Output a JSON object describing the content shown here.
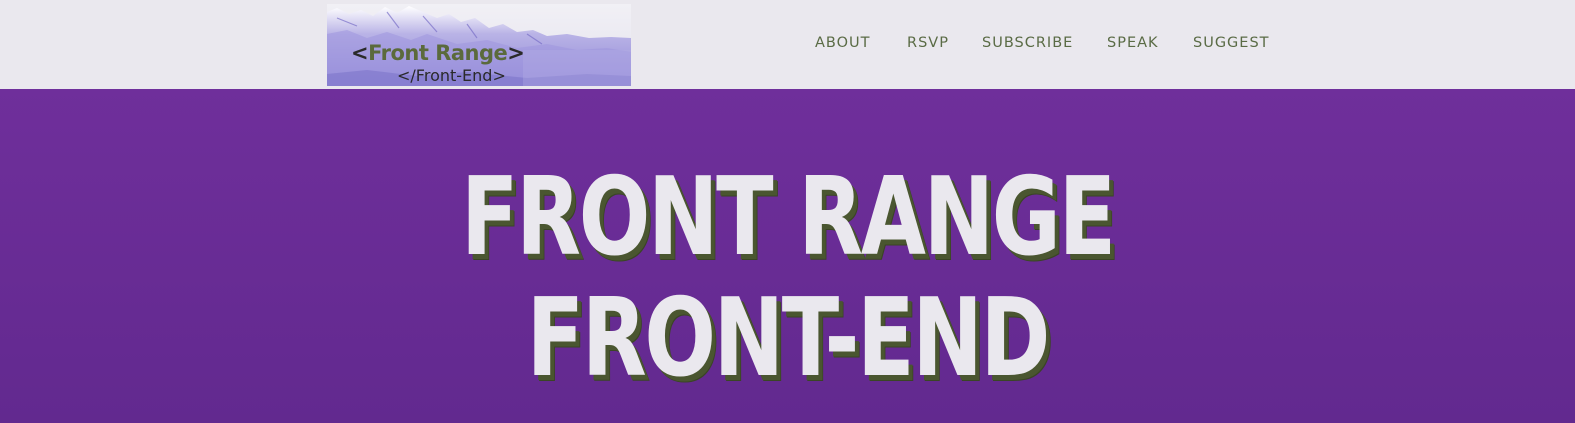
{
  "header": {
    "logo": {
      "line1": "Front Range",
      "line1_open": "<",
      "line1_close": ">",
      "line2": "</Front-End>"
    },
    "nav": [
      {
        "label": "ABOUT"
      },
      {
        "label": "RSVP"
      },
      {
        "label": "SUBSCRIBE"
      },
      {
        "label": "SPEAK"
      },
      {
        "label": "SUGGEST"
      }
    ]
  },
  "hero": {
    "title_line1": "FRONT RANGE",
    "title_line2": "FRONT-END"
  },
  "colors": {
    "header_bg": "#eae8ee",
    "hero_bg": "#6a2e98",
    "nav_text": "#5a6b45",
    "hero_text": "#eae8ee",
    "hero_shadow": "#4a5630"
  }
}
